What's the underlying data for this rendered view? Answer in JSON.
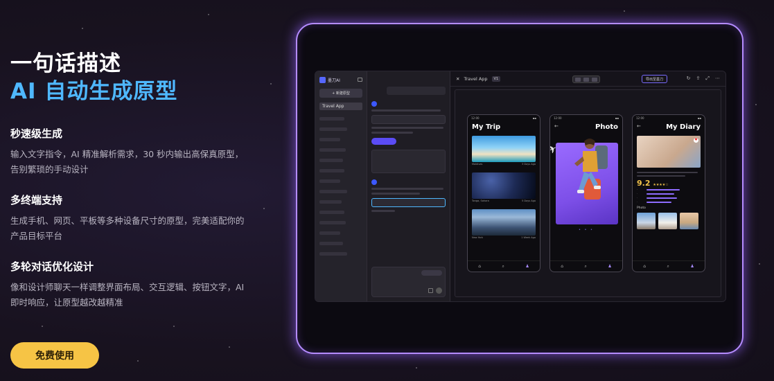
{
  "hero": {
    "title_line1": "一句话描述",
    "title_line2": "AI 自动生成原型",
    "features": [
      {
        "title": "秒速级生成",
        "desc": "输入文字指令，AI 精准解析需求，30 秒内输出高保真原型，告别繁琐的手动设计"
      },
      {
        "title": "多终端支持",
        "desc": "生成手机、网页、平板等多种设备尺寸的原型，完美适配你的产品目标平台"
      },
      {
        "title": "多轮对话优化设计",
        "desc": "像和设计师聊天一样调整界面布局、交互逻辑、按钮文字，AI 即时响应，让原型越改越精准"
      }
    ],
    "cta_label": "免费使用"
  },
  "app": {
    "sidebar": {
      "brand": "墨刀AI",
      "new_label": "+ 新建原型",
      "active_item": "Travel App"
    },
    "preview": {
      "close_glyph": "✕",
      "project_name": "Travel App",
      "version": "V1",
      "export_label": "导出至墨刀",
      "icons": [
        "↻",
        "⇪",
        "⤢",
        "⋯"
      ]
    },
    "phones": [
      {
        "title": "My Trip",
        "status_time": "12:00",
        "captions": [
          [
            "Maldives",
            "3 Days Ago"
          ],
          [
            "Tonga, Sahara",
            "5 Days Ago"
          ],
          [
            "New York",
            "1 Week Ago"
          ]
        ],
        "nav": [
          "⌂",
          "⌕",
          "♟"
        ]
      },
      {
        "title": "Photo",
        "status_time": "12:00",
        "back": "←",
        "dots": "• • •",
        "nav": [
          "⌂",
          "⌕",
          "♟"
        ]
      },
      {
        "title": "My Diary",
        "status_time": "12:00",
        "back": "←",
        "score": "9.2",
        "rating_stars": "★★★★☆",
        "photos_label": "Photo",
        "nav": [
          "⌂",
          "⌕",
          "♟"
        ]
      }
    ]
  },
  "colors": {
    "accent_blue": "#4fb8ff",
    "cta_yellow": "#f6c445",
    "frame_glow": "#b58cff"
  }
}
